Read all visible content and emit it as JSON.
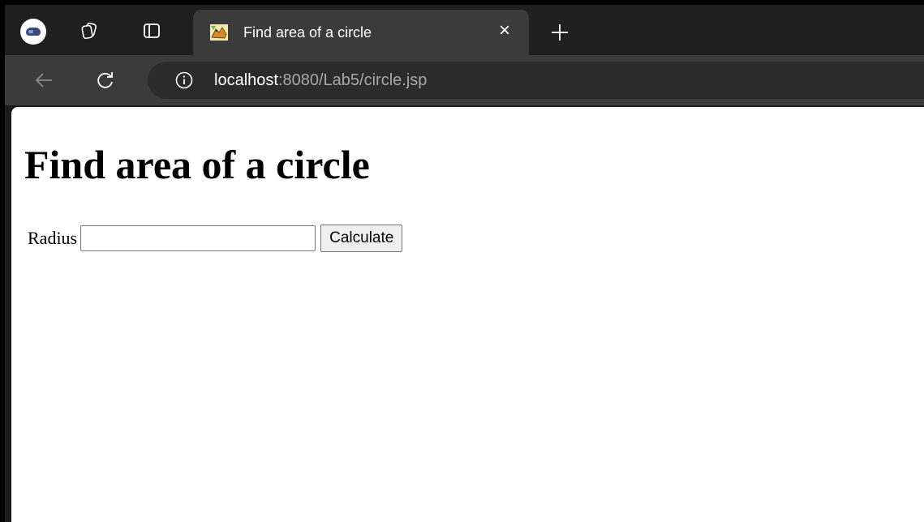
{
  "browser": {
    "tab": {
      "title": "Find area of a circle",
      "close_glyph": "×"
    },
    "address_bar": {
      "host": "localhost",
      "path": ":8080/Lab5/circle.jsp"
    },
    "icons": [
      "profile-avatar",
      "workspaces-icon",
      "vertical-tabs-icon",
      "tomcat-favicon",
      "close-icon",
      "new-tab-icon",
      "back-icon",
      "reload-icon",
      "info-icon"
    ],
    "colors": {
      "tab_strip": "#1f1f1f",
      "toolbar": "#3b3b3b",
      "omnibox": "#2b2b2b",
      "url_host": "#ffffff",
      "url_path": "#a8a8a8"
    }
  },
  "page": {
    "heading": "Find area of a circle",
    "form": {
      "radius_label": "Radius",
      "radius_value": "",
      "calculate_label": "Calculate"
    }
  }
}
